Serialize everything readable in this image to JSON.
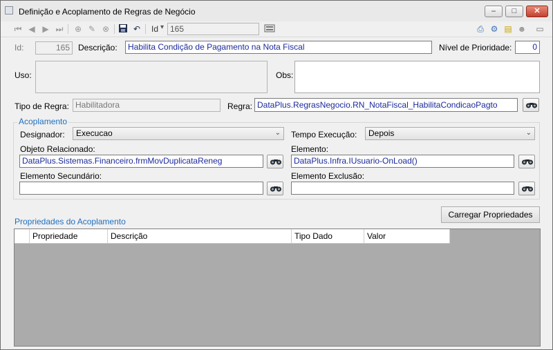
{
  "window": {
    "title": "Definição e Acoplamento de Regras de Negócio",
    "controls": {
      "minimize": "–",
      "maximize": "□",
      "close": "✕"
    }
  },
  "toolbar": {
    "id_label": "Id",
    "id_dropdown_arrow": "▾",
    "id_value": "165"
  },
  "form": {
    "id_label": "Id:",
    "id_value": "165",
    "descricao_label": "Descrição:",
    "descricao_value": "Habilita Condição de Pagamento na Nota Fiscal",
    "prioridade_label": "Nível de Prioridade:",
    "prioridade_value": "0",
    "uso_label": "Uso:",
    "obs_label": "Obs:",
    "tipo_label": "Tipo de Regra:",
    "tipo_value": "Habilitadora",
    "regra_label": "Regra:",
    "regra_value": "DataPlus.RegrasNegocio.RN_NotaFiscal_HabilitaCondicaoPagto"
  },
  "acoplamento": {
    "legend": "Acoplamento",
    "designador_label": "Designador:",
    "designador_value": "Execucao",
    "tempo_label": "Tempo Execução:",
    "tempo_value": "Depois",
    "objeto_label": "Objeto Relacionado:",
    "objeto_value": "DataPlus.Sistemas.Financeiro.frmMovDuplicataReneg",
    "elemento_label": "Elemento:",
    "elemento_value": "DataPlus.Infra.IUsuario-OnLoad()",
    "secundario_label": "Elemento Secundário:",
    "secundario_value": "",
    "exclusao_label": "Elemento Exclusão:",
    "exclusao_value": ""
  },
  "propriedades": {
    "title": "Propriedades do Acoplamento",
    "carregar_button": "Carregar Propriedades",
    "columns": [
      "Propriedade",
      "Descrição",
      "Tipo Dado",
      "Valor"
    ]
  },
  "colors": {
    "accent_blue": "#1e6fc0",
    "value_text": "#1b2a9a",
    "grid_bg": "#ababab"
  }
}
